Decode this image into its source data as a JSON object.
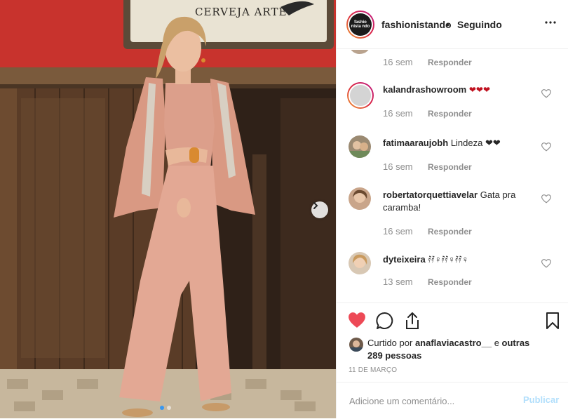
{
  "photo": {
    "sign_text": "CERVEJA ARTE",
    "carousel_dots": 2,
    "carousel_active": 1
  },
  "header": {
    "username": "fashionistando",
    "separator": "•",
    "follow_status": "Seguindo",
    "avatar_logo": "fashio nista ndo",
    "more_icon": "more-icon"
  },
  "comments": [
    {
      "username": "",
      "text": "",
      "time": "16 sem",
      "reply": "Responder",
      "partial": true
    },
    {
      "username": "kalandrashowroom",
      "text": "❤❤❤",
      "time": "16 sem",
      "reply": "Responder"
    },
    {
      "username": "fatimaaraujobh",
      "text": "Lindeza ❤❤",
      "time": "16 sem",
      "reply": "Responder"
    },
    {
      "username": "robertatorquettiavelar",
      "text": "Gata pra caramba!",
      "time": "16 sem",
      "reply": "Responder"
    },
    {
      "username": "dyteixeira",
      "text": "𝅀𝅀♀𝅀𝅀♀𝅀𝅀♀",
      "time": "13 sem",
      "reply": "Responder"
    }
  ],
  "actions": {
    "like_icon": "heart-filled-icon",
    "comment_icon": "comment-icon",
    "share_icon": "share-icon",
    "save_icon": "bookmark-icon",
    "like_color": "#ed4956"
  },
  "likes": {
    "prefix": "Curtido por",
    "user": "anaflaviacastro__",
    "connector": "e",
    "others": "outras 289 pessoas"
  },
  "date": "11 DE MARÇO",
  "add_comment": {
    "placeholder": "Adicione um comentário...",
    "publish_label": "Publicar"
  }
}
